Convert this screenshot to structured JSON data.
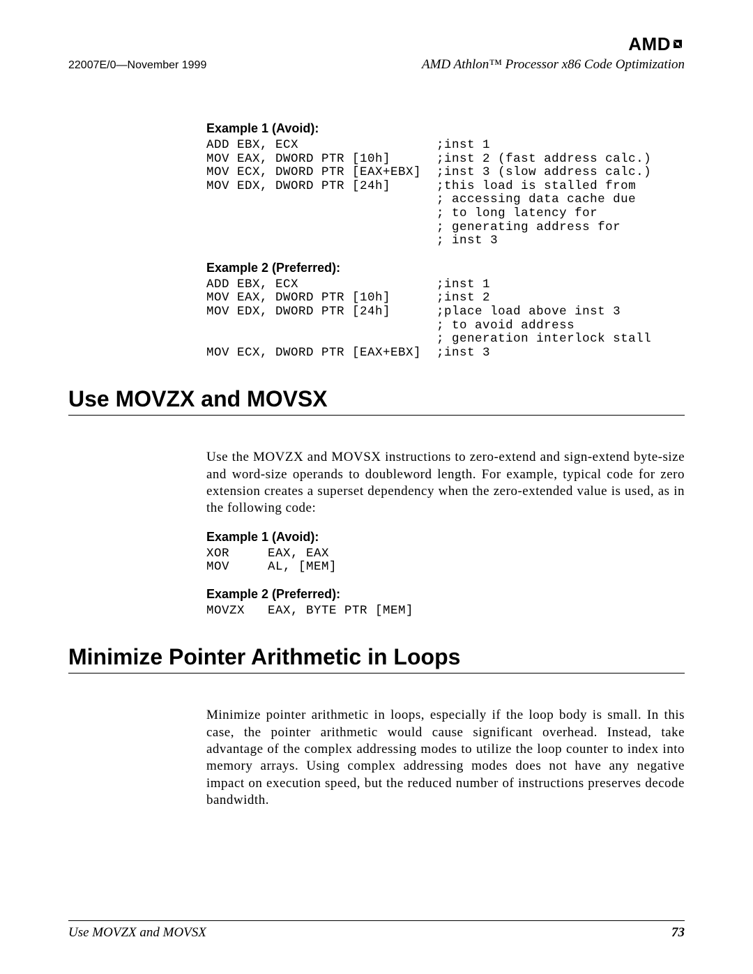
{
  "header": {
    "logo": "AMD",
    "doc_id": "22007E/0—November 1999",
    "doc_title": "AMD Athlon™ Processor x86 Code Optimization"
  },
  "section1": {
    "ex1_title": "Example 1 (Avoid):",
    "ex1_code": "ADD EBX, ECX                  ;inst 1\nMOV EAX, DWORD PTR [10h]      ;inst 2 (fast address calc.)\nMOV ECX, DWORD PTR [EAX+EBX]  ;inst 3 (slow address calc.)\nMOV EDX, DWORD PTR [24h]      ;this load is stalled from\n                              ; accessing data cache due\n                              ; to long latency for\n                              ; generating address for\n                              ; inst 3",
    "ex2_title": "Example 2 (Preferred):",
    "ex2_code": "ADD EBX, ECX                  ;inst 1\nMOV EAX, DWORD PTR [10h]      ;inst 2\nMOV EDX, DWORD PTR [24h]      ;place load above inst 3\n                              ; to avoid address\n                              ; generation interlock stall\nMOV ECX, DWORD PTR [EAX+EBX]  ;inst 3"
  },
  "section2": {
    "heading": "Use MOVZX and MOVSX",
    "body": "Use the MOVZX and MOVSX instructions to zero-extend and sign-extend byte-size and word-size operands to doubleword length. For example, typical code for zero extension creates a superset dependency when the zero-extended value is used, as in the following code:",
    "ex1_title": "Example 1 (Avoid):",
    "ex1_code": "XOR     EAX, EAX\nMOV     AL, [MEM]",
    "ex2_title": "Example 2 (Preferred):",
    "ex2_code": "MOVZX   EAX, BYTE PTR [MEM]"
  },
  "section3": {
    "heading": "Minimize Pointer Arithmetic in Loops",
    "body": "Minimize pointer arithmetic in loops, especially if the loop body is small. In this case, the pointer arithmetic would cause significant overhead. Instead, take advantage of the complex addressing modes to utilize the loop counter to index into memory arrays. Using complex addressing modes does not have any negative impact on execution speed, but the reduced number of instructions preserves decode bandwidth."
  },
  "footer": {
    "left": "Use MOVZX and MOVSX",
    "page": "73"
  }
}
